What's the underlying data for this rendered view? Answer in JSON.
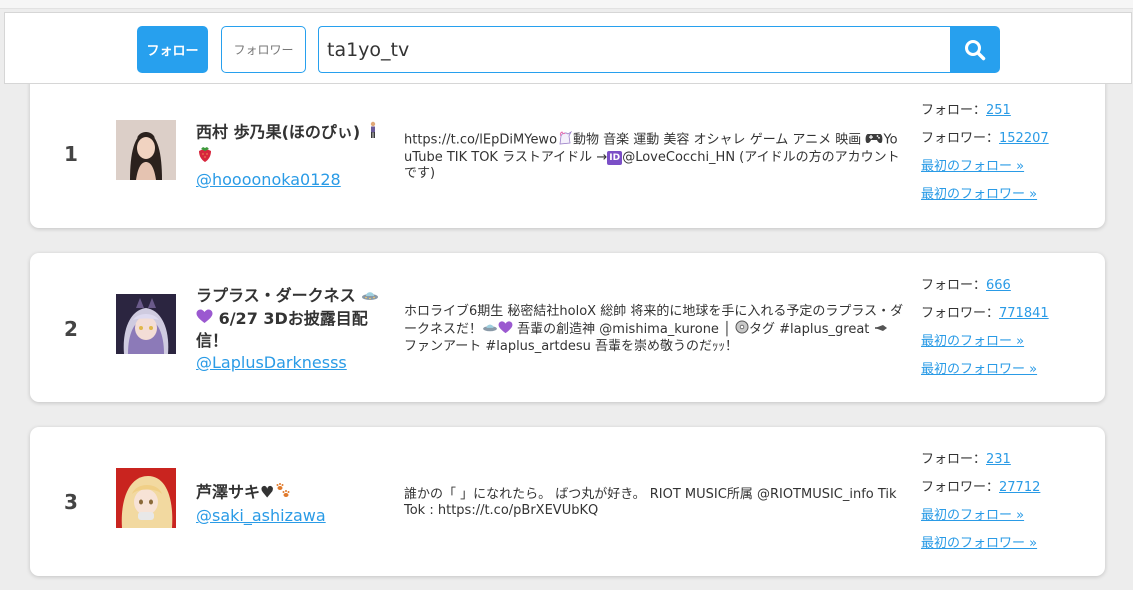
{
  "header": {
    "follow_tab_label": "フォロー",
    "follower_tab_label": "フォロワー",
    "search_value": "ta1yo_tv",
    "search_icon": "search-icon",
    "accent_color": "#27a0ee"
  },
  "results": [
    {
      "rank": "1",
      "name": "西村 歩乃果(ほのぴぃ)",
      "name_emojis": [
        "standing-person-emoji",
        "strawberry-emoji"
      ],
      "handle": "@hoooonoka0128",
      "bio_part1": "https://t.co/lEpDiMYewo",
      "bio_icon": "unicorn-emoji",
      "bio_part2": "動物 音楽 運動 美容 オシャレ ゲーム アニメ 映画 ",
      "bio_icon2": "game-controller-emoji",
      "bio_part3": "YouTube TIK TOK ラストアイドル →",
      "bio_icon3": "id-badge-emoji",
      "bio_part4": "@LoveCocchi_HN (アイドルの方のアカウントです)",
      "follow_label": "フォロー：",
      "follow_count": "251",
      "follower_label": "フォロワー：",
      "follower_count": "152207",
      "first_follow_link": "最初のフォロー »",
      "first_follower_link": "最初のフォロワー »"
    },
    {
      "rank": "2",
      "name_part1": "ラプラス・ダークネス",
      "name_part2": " 6/27 3Dお披露目配信！",
      "name_emojis": [
        "ufo-emoji",
        "purple-heart-emoji"
      ],
      "handle": "@LaplusDarknesss",
      "bio_part1": "ホロライブ6期生 秘密結社holoX 総帥 将来的に地球を手に入れる予定のラプラス・ダークネスだ！",
      "bio_part2": " 吾輩の創造神 @mishima_kurone │ ",
      "bio_part3": "タグ #laplus_great ",
      "bio_part4": " ファンアート #laplus_artdesu 吾輩を崇め敬うのだｯｯ！",
      "bio_icons": [
        "ufo-emoji",
        "purple-heart-emoji",
        "dvd-emoji",
        "pen-emoji"
      ],
      "follow_label": "フォロー：",
      "follow_count": "666",
      "follower_label": "フォロワー：",
      "follower_count": "771841",
      "first_follow_link": "最初のフォロー »",
      "first_follower_link": "最初のフォロワー »"
    },
    {
      "rank": "3",
      "name": "芦澤サキ♥",
      "name_emojis": [
        "paw-prints-emoji"
      ],
      "handle": "@saki_ashizawa",
      "bio": "誰かの「 」になれたら。 ばつ丸が好き。 RIOT MUSIC所属 @RIOTMUSIC_info TikTok : https://t.co/pBrXEVUbKQ",
      "follow_label": "フォロー：",
      "follow_count": "231",
      "follower_label": "フォロワー：",
      "follower_count": "27712",
      "first_follow_link": "最初のフォロー »",
      "first_follower_link": "最初のフォロワー »"
    }
  ]
}
